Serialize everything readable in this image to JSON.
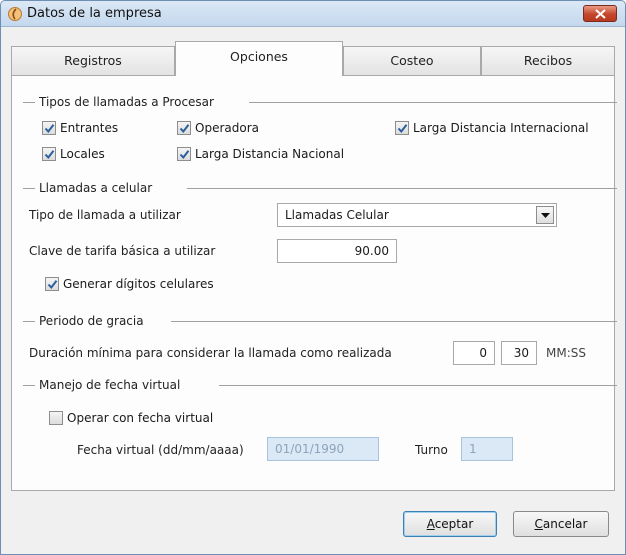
{
  "window": {
    "title": "Datos de la empresa"
  },
  "tabs": [
    {
      "label": "Registros",
      "active": false
    },
    {
      "label": "Opciones",
      "active": true
    },
    {
      "label": "Costeo",
      "active": false
    },
    {
      "label": "Recibos",
      "active": false
    }
  ],
  "tipos": {
    "header": "Tipos de llamadas a Procesar",
    "entrantes": "Entrantes",
    "operadora": "Operadora",
    "larga_internacional": "Larga Distancia Internacional",
    "locales": "Locales",
    "larga_nacional": "Larga Distancia Nacional"
  },
  "celular": {
    "header": "Llamadas a celular",
    "tipo_label": "Tipo de llamada a utilizar",
    "tipo_value": "Llamadas Celular",
    "clave_label": "Clave de tarifa básica a utilizar",
    "clave_value": "90.00",
    "generar_label": "Generar dígitos celulares"
  },
  "gracia": {
    "header": "Periodo de gracia",
    "duracion_label": "Duración mínima para considerar la llamada como realizada",
    "mm_value": "0",
    "ss_value": "30",
    "unit": "MM:SS"
  },
  "virtual": {
    "header": "Manejo de fecha virtual",
    "operar_label": "Operar con fecha virtual",
    "fecha_label": "Fecha virtual (dd/mm/aaaa)",
    "fecha_value": "01/01/1990",
    "turno_label": "Turno",
    "turno_value": "1"
  },
  "buttons": {
    "aceptar_first": "A",
    "aceptar_rest": "ceptar",
    "cancelar_first": "C",
    "cancelar_rest": "ancelar"
  },
  "colors": {
    "accent": "#3c7fb1",
    "disabled_field": "#dbe9f6",
    "close": "#c4472b"
  }
}
